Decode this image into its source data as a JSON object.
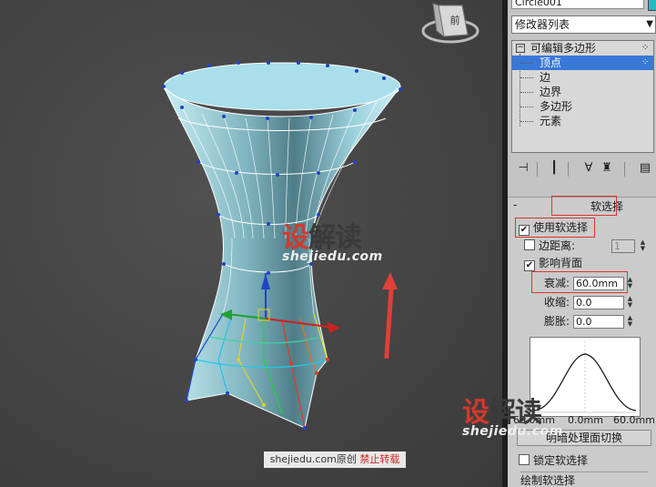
{
  "viewport": {
    "viewcube_label": "前",
    "colors": {
      "mesh_fill": "#a8dfea",
      "selected_edge": "#1e44c8",
      "arrow": "#e04038"
    }
  },
  "watermark_viewport": {
    "chars": [
      "设",
      "解",
      "读"
    ],
    "url": "shejiedu.com"
  },
  "watermark_panel": {
    "chars": [
      "设",
      "解",
      "读"
    ],
    "url": "shejiedu.com"
  },
  "credit": {
    "site": "shejiedu.com",
    "original": "原创",
    "forbid": "禁止转载"
  },
  "panel": {
    "object_name": "Circle001",
    "object_color": "#2ab7c0",
    "modifier_list": "修改器列表",
    "stack": {
      "root": "可编辑多边形",
      "items": [
        "顶点",
        "边",
        "边界",
        "多边形",
        "元素"
      ],
      "selected_index": 0
    },
    "soft_selection": {
      "title": "软选择",
      "use_soft_selection": "使用软选择",
      "use_checked": true,
      "edge_distance": "边距离:",
      "edge_distance_value": "1",
      "affect_backfacing": "影响背面",
      "affect_checked": true,
      "falloff_label": "衰减:",
      "falloff_value": "60.0mm",
      "pinch_label": "收缩:",
      "pinch_value": "0.0",
      "bubble_label": "膨胀:",
      "bubble_value": "0.0",
      "curve_labels": [
        "60.0mm",
        "0.0mm",
        "60.0mm"
      ],
      "shaded_face_toggle": "明暗处理面切换",
      "lock_soft_selection": "锁定软选择",
      "paint_soft_selection": "绘制软选择"
    }
  }
}
